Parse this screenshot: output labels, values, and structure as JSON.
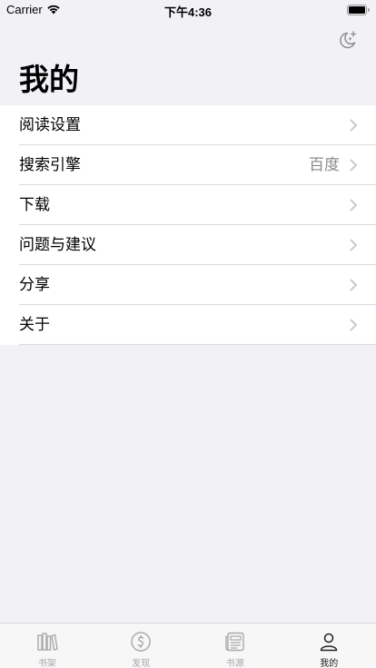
{
  "status_bar": {
    "carrier": "Carrier",
    "time": "下午4:36"
  },
  "header": {
    "title": "我的",
    "theme_toggle_icon": "moon-stars-icon"
  },
  "settings": {
    "items": [
      {
        "label": "阅读设置",
        "value": ""
      },
      {
        "label": "搜索引擎",
        "value": "百度"
      },
      {
        "label": "下载",
        "value": ""
      },
      {
        "label": "问题与建议",
        "value": ""
      },
      {
        "label": "分享",
        "value": ""
      },
      {
        "label": "关于",
        "value": ""
      }
    ]
  },
  "tabbar": {
    "tabs": [
      {
        "label": "书架",
        "icon": "bookshelf-icon"
      },
      {
        "label": "发现",
        "icon": "discover-icon"
      },
      {
        "label": "书源",
        "icon": "book-source-icon"
      },
      {
        "label": "我的",
        "icon": "person-icon"
      }
    ],
    "active_index": 3
  },
  "colors": {
    "background": "#f2f1f6",
    "row_background": "#ffffff",
    "secondary_text": "#8a8a8e",
    "tab_inactive": "#a8a8ac",
    "tab_active": "#222222"
  }
}
